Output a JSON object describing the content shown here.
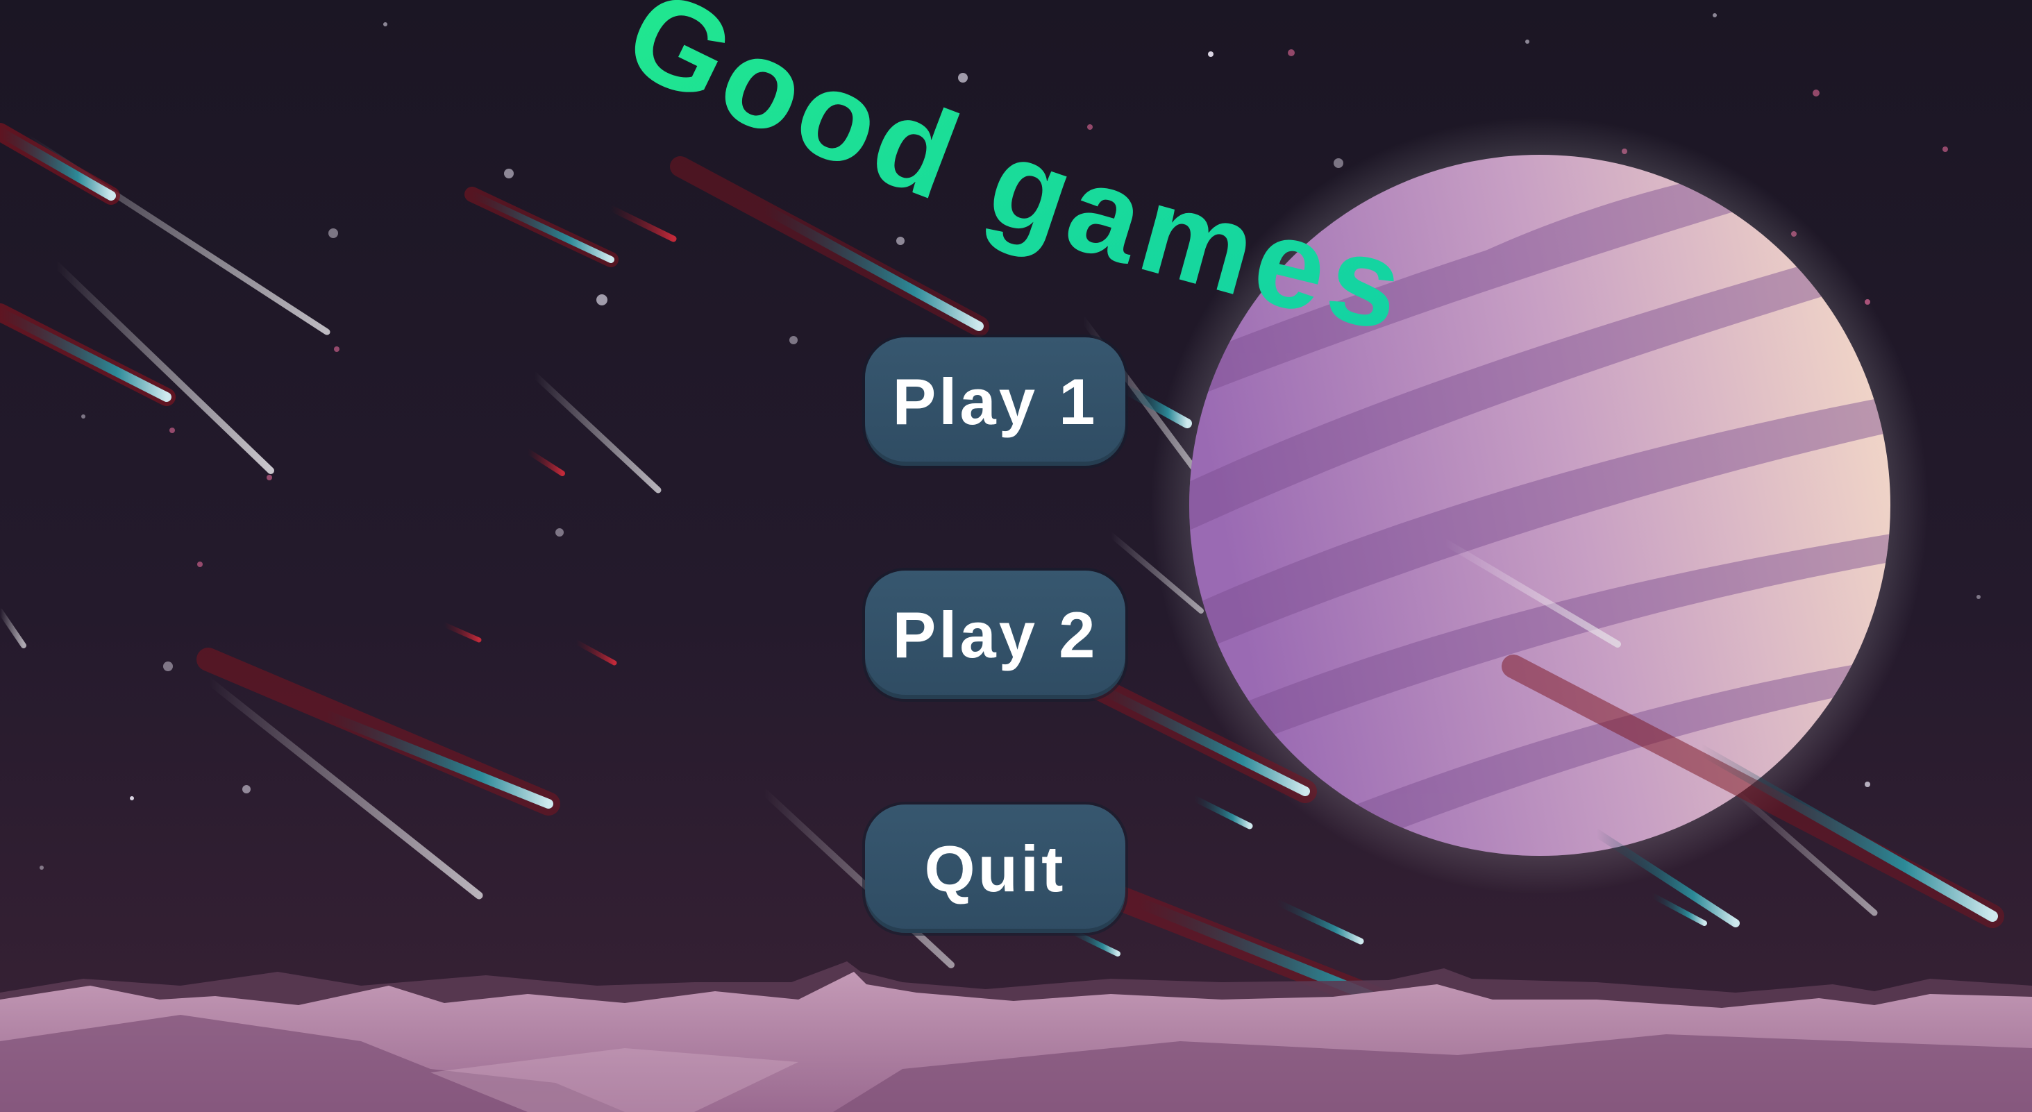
{
  "game": {
    "title": "Good games",
    "title_color": "#19e29a",
    "menu": {
      "play1_label": "Play 1",
      "play2_label": "Play 2",
      "quit_label": "Quit",
      "button_color": "#355570",
      "label_color": "#ffffff"
    }
  },
  "scene": {
    "background": "night-sky-with-meteors",
    "planet": "striped-purple-planet",
    "ground": "pink-rocky-horizon",
    "sky_color": "#1c1626",
    "planet_color": "#b98cc0",
    "ground_color": "#a07196"
  }
}
